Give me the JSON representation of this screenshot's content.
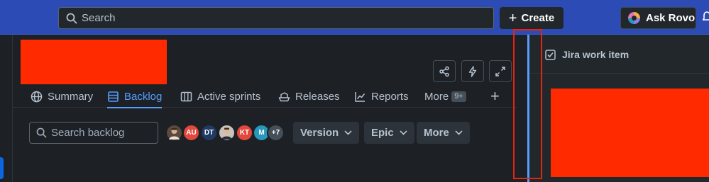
{
  "topbar": {
    "search_placeholder": "Search",
    "create_label": "Create",
    "rovo_label": "Ask Rovo",
    "icons": [
      "search-icon",
      "plus-icon",
      "rovo-logo-icon",
      "bell-icon"
    ]
  },
  "project": {
    "header_actions": [
      "share-icon",
      "automation-icon",
      "fullscreen-icon"
    ]
  },
  "tabs": [
    {
      "label": "Summary",
      "icon": "globe-icon",
      "active": false
    },
    {
      "label": "Backlog",
      "icon": "backlog-icon",
      "active": true
    },
    {
      "label": "Active sprints",
      "icon": "board-icon",
      "active": false
    },
    {
      "label": "Releases",
      "icon": "ship-icon",
      "active": false
    },
    {
      "label": "Reports",
      "icon": "chart-icon",
      "active": false
    },
    {
      "label": "More",
      "badge": "9+",
      "active": false
    }
  ],
  "toolbar": {
    "search_placeholder": "Search backlog",
    "avatars": [
      {
        "initials": "",
        "kind": "photo",
        "color": "#5a4a3f"
      },
      {
        "initials": "AU",
        "color": "#e2483d"
      },
      {
        "initials": "DT",
        "color": "#1f3a63"
      },
      {
        "initials": "",
        "kind": "photo",
        "color": "#c9c3bb"
      },
      {
        "initials": "KT",
        "color": "#e2483d"
      },
      {
        "initials": "M",
        "color": "#2898bd"
      },
      {
        "initials": "+7",
        "color": "#454f59"
      }
    ],
    "filters": [
      "Version",
      "Epic",
      "More"
    ]
  },
  "panel": {
    "title": "Jira work item",
    "title_icon": "checkbox-icon"
  },
  "colors": {
    "topbar": "#2d4bb4",
    "accent": "#579dff",
    "redaction": "#ff2a00",
    "highlight_box": "#e8230f"
  }
}
